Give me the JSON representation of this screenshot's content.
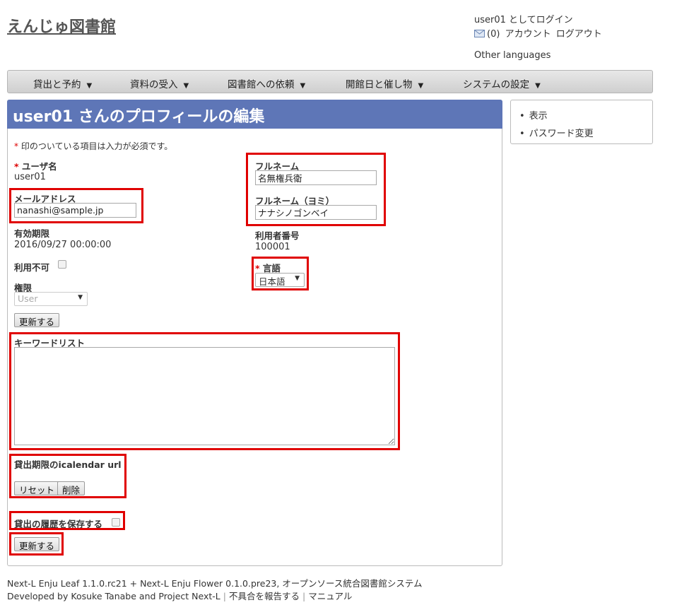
{
  "header": {
    "site_title": "えんじゅ図書館",
    "login_status": "user01 としてログイン",
    "message_count": "(0)",
    "account_link": "アカウント",
    "logout_link": "ログアウト",
    "other_languages": "Other languages"
  },
  "menu": [
    {
      "label": "貸出と予約"
    },
    {
      "label": "資料の受入"
    },
    {
      "label": "図書館への依頼"
    },
    {
      "label": "開館日と催し物"
    },
    {
      "label": "システムの設定"
    }
  ],
  "page": {
    "title": "user01 さんのプロフィールの編集",
    "required_mark": "*",
    "required_note": "印のついている項目は入力が必須です。"
  },
  "sidebar": {
    "items": [
      {
        "label": "表示"
      },
      {
        "label": "パスワード変更"
      }
    ]
  },
  "form": {
    "username_label": "ユーザ名",
    "username_value": "user01",
    "email_label": "メールアドレス",
    "email_value": "nanashi@sample.jp",
    "expiry_label": "有効期限",
    "expiry_value": "2016/09/27 00:00:00",
    "locked_label": "利用不可",
    "role_label": "権限",
    "role_value": "User",
    "update_button": "更新する",
    "fullname_label": "フルネーム",
    "fullname_value": "名無権兵衛",
    "fullname_kana_label": "フルネーム（ヨミ）",
    "fullname_kana_value": "ナナシノゴンベイ",
    "user_number_label": "利用者番号",
    "user_number_value": "100001",
    "locale_label": "言語",
    "locale_value": "日本語",
    "keyword_list_label": "キーワードリスト",
    "keyword_list_value": "",
    "icalendar_label": "貸出期限のicalendar url",
    "reset_button": "リセット",
    "delete_button": "削除",
    "save_history_label": "貸出の履歴を保存する",
    "submit_button": "更新する"
  },
  "footer": {
    "enju_leaf": "Next-L Enju Leaf 1.1.0.rc21",
    "plus": " + ",
    "enju_flower": "Next-L Enju Flower 0.1.0.pre23",
    "system_desc": ", オープンソース統合図書館システム",
    "developed_by": "Developed by ",
    "author": "Kosuke Tanabe",
    "and": " and ",
    "project": "Project Next-L",
    "separator": "|",
    "report_bug": "不具合を報告する",
    "manual": "マニュアル"
  },
  "colors": {
    "title_bar": "#5e76b7",
    "highlight": "#e00000",
    "required": "#dd0000"
  }
}
